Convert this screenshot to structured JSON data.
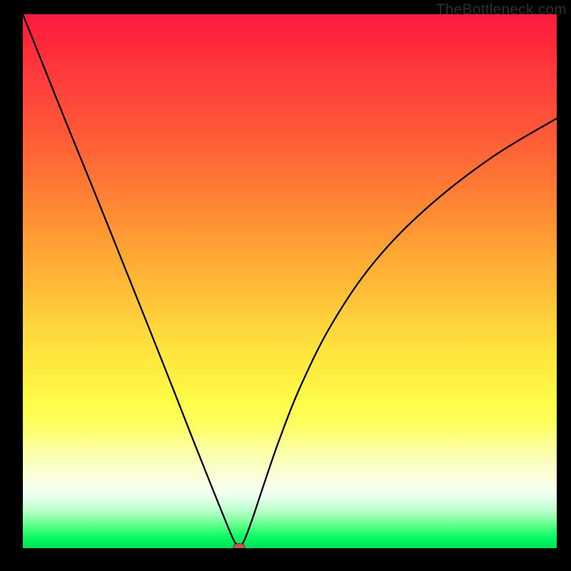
{
  "watermark": "TheBottleneck.com",
  "chart_data": {
    "type": "line",
    "title": "",
    "xlabel": "",
    "ylabel": "",
    "x_range": [
      0,
      1
    ],
    "y_range": [
      0,
      1
    ],
    "legend": false,
    "grid": false,
    "background": "vertical_gradient_red_yellow_green",
    "minimum_marker": {
      "x": 0.405,
      "y": 0.0,
      "style": "small_red_oval"
    },
    "series": [
      {
        "name": "curve",
        "color": "#000000",
        "x": [
          0.0,
          0.04,
          0.08,
          0.12,
          0.16,
          0.2,
          0.24,
          0.28,
          0.32,
          0.355,
          0.38,
          0.395,
          0.405,
          0.415,
          0.43,
          0.45,
          0.48,
          0.52,
          0.58,
          0.66,
          0.76,
          0.88,
          1.0
        ],
        "y": [
          1.0,
          0.9,
          0.8,
          0.702,
          0.603,
          0.503,
          0.403,
          0.302,
          0.2,
          0.112,
          0.05,
          0.015,
          0.0,
          0.015,
          0.055,
          0.115,
          0.202,
          0.303,
          0.422,
          0.538,
          0.64,
          0.733,
          0.805
        ]
      }
    ]
  }
}
